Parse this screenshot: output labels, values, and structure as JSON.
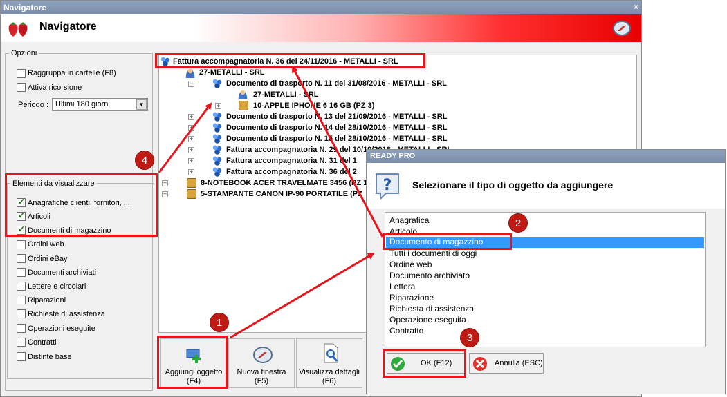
{
  "window": {
    "title_bar": "Navigatore",
    "header_title": "Navigatore",
    "close_glyph": "×"
  },
  "options": {
    "legend": "Opzioni",
    "group_folders": "Raggruppa in cartelle (F8)",
    "recursion": "Attiva ricorsione",
    "period_label": "Periodo :",
    "period_value": "Ultimi 180 giorni"
  },
  "elements": {
    "legend": "Elementi da visualizzare",
    "items": [
      {
        "label": "Anagrafiche clienti, fornitori, ...",
        "checked": true
      },
      {
        "label": "Articoli",
        "checked": true
      },
      {
        "label": "Documenti di magazzino",
        "checked": true
      },
      {
        "label": "Ordini web",
        "checked": false
      },
      {
        "label": "Ordini eBay",
        "checked": false
      },
      {
        "label": "Documenti archiviati",
        "checked": false
      },
      {
        "label": "Lettere e circolari",
        "checked": false
      },
      {
        "label": "Riparazioni",
        "checked": false
      },
      {
        "label": "Richieste di assistenza",
        "checked": false
      },
      {
        "label": "Operazioni eseguite",
        "checked": false
      },
      {
        "label": "Contratti",
        "checked": false
      },
      {
        "label": "Distinte base",
        "checked": false
      }
    ]
  },
  "tree": {
    "root": "Fattura accompagnatoria N. 36 del 24/11/2016 - METALLI - SRL",
    "nodes": [
      "27-METALLI - SRL",
      "Documento di trasporto N. 11 del 31/08/2016 - METALLI - SRL",
      "27-METALLI - SRL",
      "10-APPLE IPHONE 6 16 GB (PZ 3)",
      "Documento di trasporto N. 13 del 21/09/2016 - METALLI - SRL",
      "Documento di trasporto N. 14 del 28/10/2016 - METALLI - SRL",
      "Documento di trasporto N. 15 del 28/10/2016 - METALLI - SRL",
      "Fattura accompagnatoria N. 29 del 10/10/2016 - METALLI - SRL",
      "Fattura accompagnatoria N. 31 del 1",
      "Fattura accompagnatoria N. 36 del 2",
      "8-NOTEBOOK ACER TRAVELMATE 3456 (PZ 1",
      "5-STAMPANTE CANON IP-90 PORTATILE (PZ"
    ]
  },
  "toolbar": {
    "add_object": {
      "line1": "Aggiungi oggetto",
      "line2": "(F4)"
    },
    "new_window": {
      "line1": "Nuova finestra",
      "line2": "(F5)"
    },
    "details": {
      "line1": "Visualizza dettagli",
      "line2": "(F6)"
    }
  },
  "dialog": {
    "title": "READY PRO",
    "prompt": "Selezionare il tipo di oggetto da aggiungere",
    "options": [
      "Anagrafica",
      "Articolo",
      "Documento di magazzino",
      "Tutti i documenti di oggi",
      "Ordine web",
      "Documento archiviato",
      "Lettera",
      "Riparazione",
      "Richiesta di assistenza",
      "Operazione eseguita",
      "Contratto"
    ],
    "selected_index": 2,
    "ok_label": "OK (F12)",
    "cancel_label": "Annulla (ESC)"
  },
  "annotations": {
    "n1": "1",
    "n2": "2",
    "n3": "3",
    "n4": "4"
  },
  "colors": {
    "highlight": "#e8141b",
    "selection": "#3399ff",
    "header_red": "#e80000"
  }
}
